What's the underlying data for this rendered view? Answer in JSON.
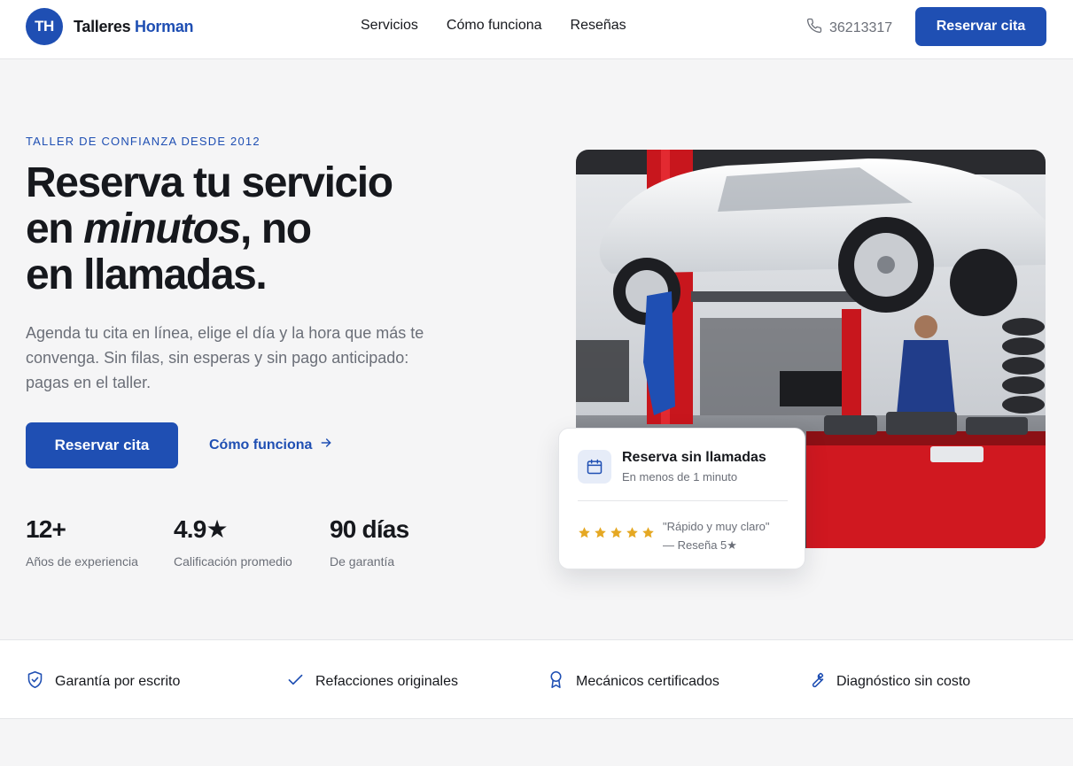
{
  "nav": {
    "brand_initials": "TH",
    "brand_name_1": "Talleres",
    "brand_name_2": "Horman",
    "links": [
      "Servicios",
      "Cómo funciona",
      "Reseñas"
    ],
    "phone": "36213317",
    "cta_label": "Reservar cita",
    "icons": {
      "phone": "phone-icon"
    }
  },
  "hero": {
    "eyebrow": "TALLER DE CONFIANZA DESDE 2012",
    "title_line1": "Reserva tu servicio",
    "title_line2_pre": "en ",
    "title_line2_em": "minutos",
    "title_line2_post": ", no",
    "title_line3": "en llamadas.",
    "description": "Agenda tu cita en línea, elige el día y la hora que más te convenga. Sin filas, sin esperas y sin pago anticipado: pagas en el taller.",
    "cta_label": "Reservar cita",
    "secondary_label": "Cómo funciona",
    "stats": [
      {
        "value": "12+",
        "label": "Años de experiencia"
      },
      {
        "value": "4.9★",
        "label": "Calificación promedio"
      },
      {
        "value": "90 días",
        "label": "De garantía"
      }
    ]
  },
  "card": {
    "title": "Reserva sin llamadas",
    "subtitle": "En menos de 1 minuto",
    "rating": 5,
    "quote": "\"Rápido y muy claro\"",
    "quote_author": "— Reseña 5★",
    "icons": {
      "calendar": "calendar-icon",
      "star": "star-icon"
    }
  },
  "trust": [
    {
      "label": "Garantía por escrito",
      "icon": "shield-icon"
    },
    {
      "label": "Refacciones originales",
      "icon": "check-icon"
    },
    {
      "label": "Mecánicos certificados",
      "icon": "award-icon"
    },
    {
      "label": "Diagnóstico sin costo",
      "icon": "wrench-icon"
    }
  ],
  "colors": {
    "primary": "#1f4fb3",
    "text": "#16181d",
    "muted": "#6b6f78",
    "star": "#e5a823",
    "background": "#f5f5f6"
  }
}
